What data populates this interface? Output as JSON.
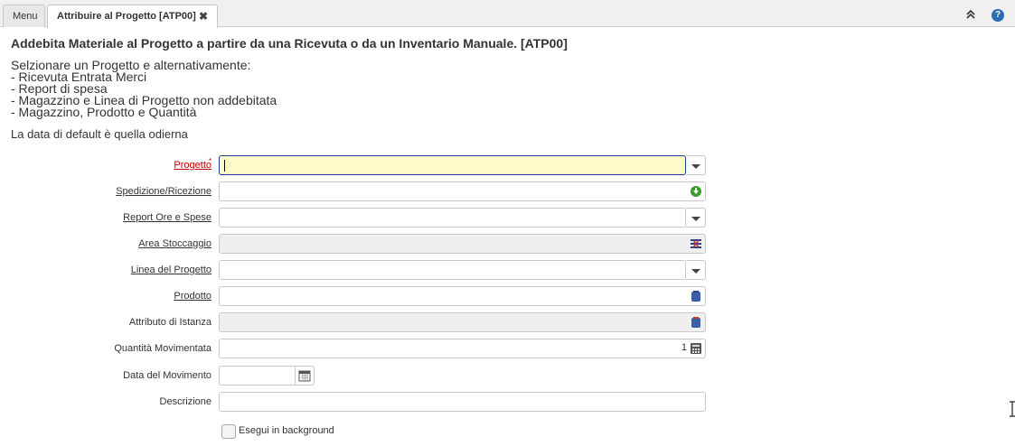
{
  "tabs": {
    "menu_label": "Menu",
    "active_label": "Attribuire al Progetto [ATP00]",
    "close_symbol": "✖"
  },
  "header": {
    "help_symbol": "?"
  },
  "title": "Addebita Materiale al Progetto a partire da una Ricevuta o da un Inventario Manuale. [ATP00]",
  "description_lines": [
    "Selzionare un Progetto e alternativamente:",
    "- Ricevuta Entrata Merci",
    "- Report di spesa",
    "- Magazzino e Linea di Progetto non addebitata",
    "- Magazzino, Prodotto e Quantità"
  ],
  "default_note": "La data di default è quella odierna",
  "form": {
    "progetto": {
      "label": "Progetto",
      "required_mark": "*",
      "value": ""
    },
    "spedizione": {
      "label": "Spedizione/Ricezione",
      "value": ""
    },
    "report": {
      "label": "Report Ore e Spese",
      "value": ""
    },
    "area": {
      "label": "Area Stoccaggio",
      "value": ""
    },
    "linea": {
      "label": "Linea del Progetto",
      "value": ""
    },
    "prodotto": {
      "label": "Prodotto",
      "value": ""
    },
    "attributo": {
      "label": "Attributo di Istanza",
      "value": ""
    },
    "quantita": {
      "label": "Quantità Movimentata",
      "value": "1"
    },
    "data": {
      "label": "Data del Movimento",
      "value": ""
    },
    "descrizione": {
      "label": "Descrizione",
      "value": ""
    },
    "background": {
      "label": "Esegui in background",
      "checked": false
    }
  },
  "icons": {
    "collapse": "double-chevron-up-icon",
    "help": "help-icon",
    "dropdown": "caret-down-icon",
    "shipment": "green-arrow-icon",
    "locator": "locator-icon",
    "product": "product-icon",
    "attribute": "attribute-icon",
    "calculator": "calculator-icon",
    "calendar": "calendar-icon"
  },
  "colors": {
    "mandatory_label": "#c00000",
    "focused_field_bg": "#fffbc8",
    "focused_border": "#1a3a9e",
    "help_blue": "#2a6db2"
  }
}
